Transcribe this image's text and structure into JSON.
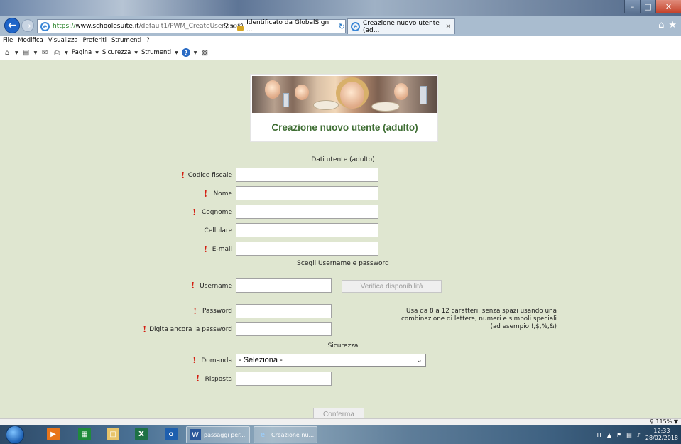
{
  "browser": {
    "url_proto": "https://",
    "url_host": "www.schoolesuite.it",
    "url_path": "/default1/PWM_CreateUser.aspx",
    "cert_text": "Identificato da GlobalSign ...",
    "tab_title": "Creazione nuovo utente (ad...",
    "menu": [
      "File",
      "Modifica",
      "Visualizza",
      "Preferiti",
      "Strumenti",
      "?"
    ],
    "commands": {
      "pagina": "Pagina",
      "sicurezza": "Sicurezza",
      "strumenti": "Strumenti"
    },
    "zoom": "115%"
  },
  "page": {
    "title": "Creazione nuovo utente (adulto)",
    "sections": {
      "dati_utente": "Dati utente (adulto)",
      "username_password": "Scegli Username e password",
      "sicurezza": "Sicurezza"
    },
    "fields": {
      "codice_fiscale": "Codice fiscale",
      "nome": "Nome",
      "cognome": "Cognome",
      "cellulare": "Cellulare",
      "email": "E-mail",
      "username": "Username",
      "password": "Password",
      "password_repeat": "Digita ancora la password",
      "domanda": "Domanda",
      "risposta": "Risposta"
    },
    "domanda_selected": "- Seleziona -",
    "verifica_button": "Verifica disponibilità",
    "conferma_button": "Conferma",
    "password_hint": "Usa da 8 a 12 caratteri, senza spazi usando una combinazione di lettere, numeri e simboli speciali (ad esempio !,$,%,&)"
  },
  "taskbar": {
    "task1": "passaggi per...",
    "task2": "Creazione nu...",
    "lang": "IT",
    "time": "12:33",
    "date": "28/02/2018"
  }
}
